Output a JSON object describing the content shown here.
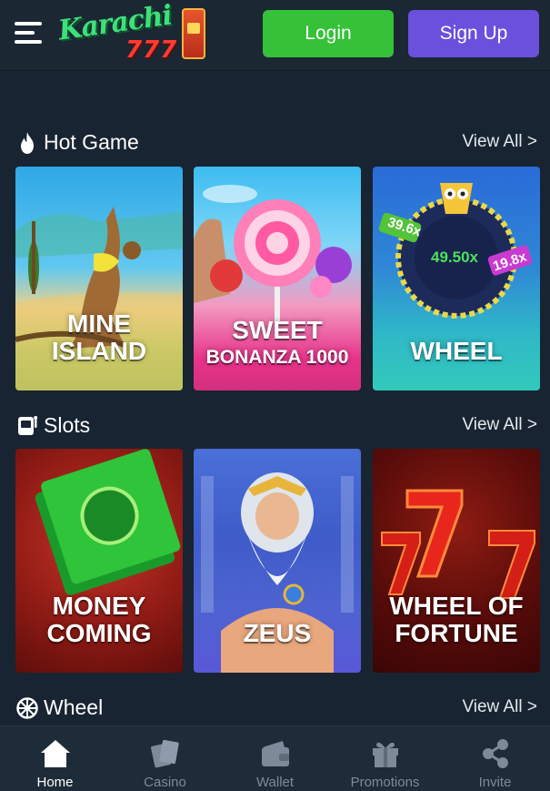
{
  "header": {
    "logo_text": "Karachi",
    "logo_number": "777",
    "login_label": "Login",
    "signup_label": "Sign Up"
  },
  "sections": [
    {
      "title": "Hot Game",
      "icon": "fire-icon",
      "view_all": "View All >",
      "cards": [
        {
          "line1": "MINE",
          "line2": "ISLAND"
        },
        {
          "line1": "SWEET",
          "line2": "BONANZA 1000"
        },
        {
          "line1": "WHEEL",
          "line2": "",
          "multipliers": [
            "39.6x",
            "49.50x",
            "19.8x"
          ]
        }
      ]
    },
    {
      "title": "Slots",
      "icon": "slot-machine-icon",
      "view_all": "View All >",
      "cards": [
        {
          "line1": "MONEY",
          "line2": "COMING"
        },
        {
          "line1": "ZEUS",
          "line2": ""
        },
        {
          "line1": "WHEEL OF",
          "line2": "FORTUNE"
        }
      ]
    },
    {
      "title": "Wheel",
      "icon": "wheel-icon",
      "view_all": "View All >"
    }
  ],
  "bottom_nav": [
    {
      "label": "Home",
      "icon": "home-icon",
      "active": true
    },
    {
      "label": "Casino",
      "icon": "cards-icon",
      "active": false
    },
    {
      "label": "Wallet",
      "icon": "wallet-icon",
      "active": false
    },
    {
      "label": "Promotions",
      "icon": "gift-icon",
      "active": false
    },
    {
      "label": "Invite",
      "icon": "share-icon",
      "active": false
    }
  ],
  "colors": {
    "background": "#182431",
    "login": "#35c138",
    "signup": "#6b4fdd",
    "nav_inactive": "#7d8a99"
  }
}
